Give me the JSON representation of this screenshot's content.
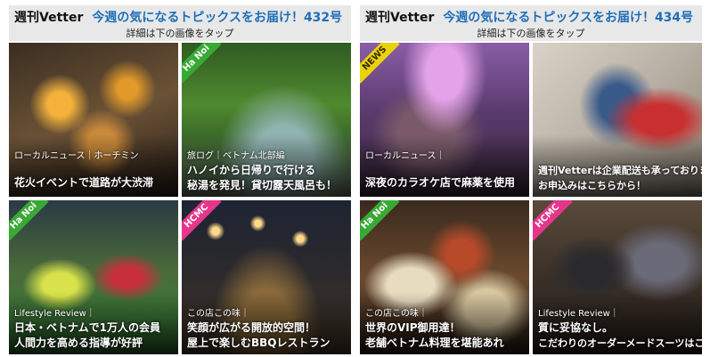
{
  "left": {
    "brand": "週刊Vetter",
    "headline": "今週の気になるトピックスをお届け！432号",
    "sub": "詳細は下の画像をタップ",
    "tiles": [
      {
        "tag": "",
        "category": "ローカルニュース｜ホーチミン",
        "line1": "花火イベントで道路が大渋滞",
        "line2": ""
      },
      {
        "tag": "Ha Noi",
        "category": "旅ログ｜ベトナム北部編",
        "line1": "ハノイから日帰りで行ける",
        "line2": "秘湯を発見！貸切露天風呂も！"
      },
      {
        "tag": "Ha Noi",
        "category": "Lifestyle Review｜",
        "line1": "日本・ベトナムで1万人の会員",
        "line2": "人間力を高める指導が好評"
      },
      {
        "tag": "HCMC",
        "category": "この店この味｜",
        "line1": "笑顔が広がる開放的空間！",
        "line2": "屋上で楽しむBBQレストラン"
      }
    ]
  },
  "right": {
    "brand": "週刊Vetter",
    "headline": "今週の気になるトピックスをお届け！434号",
    "sub": "詳細は下の画像をタップ",
    "tiles": [
      {
        "tag": "NEWS",
        "category": "ローカルニュース｜",
        "line1": "深夜のカラオケ店で麻薬を使用",
        "line2": ""
      },
      {
        "tag": "",
        "category": "",
        "line1": "週刊Vetterは企業配送も承っております",
        "line2": "お申込みはこちらから！"
      },
      {
        "tag": "Ha Noi",
        "category": "この店この味｜",
        "line1": "世界のVIP御用達！",
        "line2": "老舗ベトナム料理を堪能あれ"
      },
      {
        "tag": "HCMC",
        "category": "Lifestyle Review｜",
        "line1": "質に妥協なし。",
        "line2": "こだわりのオーダーメードスーツはここで"
      }
    ]
  },
  "colors": {
    "header_bg": "#e8e8e8",
    "headline": "#1f6fb8",
    "hanoi_tag": "#39a935",
    "hcmc_tag": "#e4368a",
    "news_tag": "#e8d30a"
  }
}
